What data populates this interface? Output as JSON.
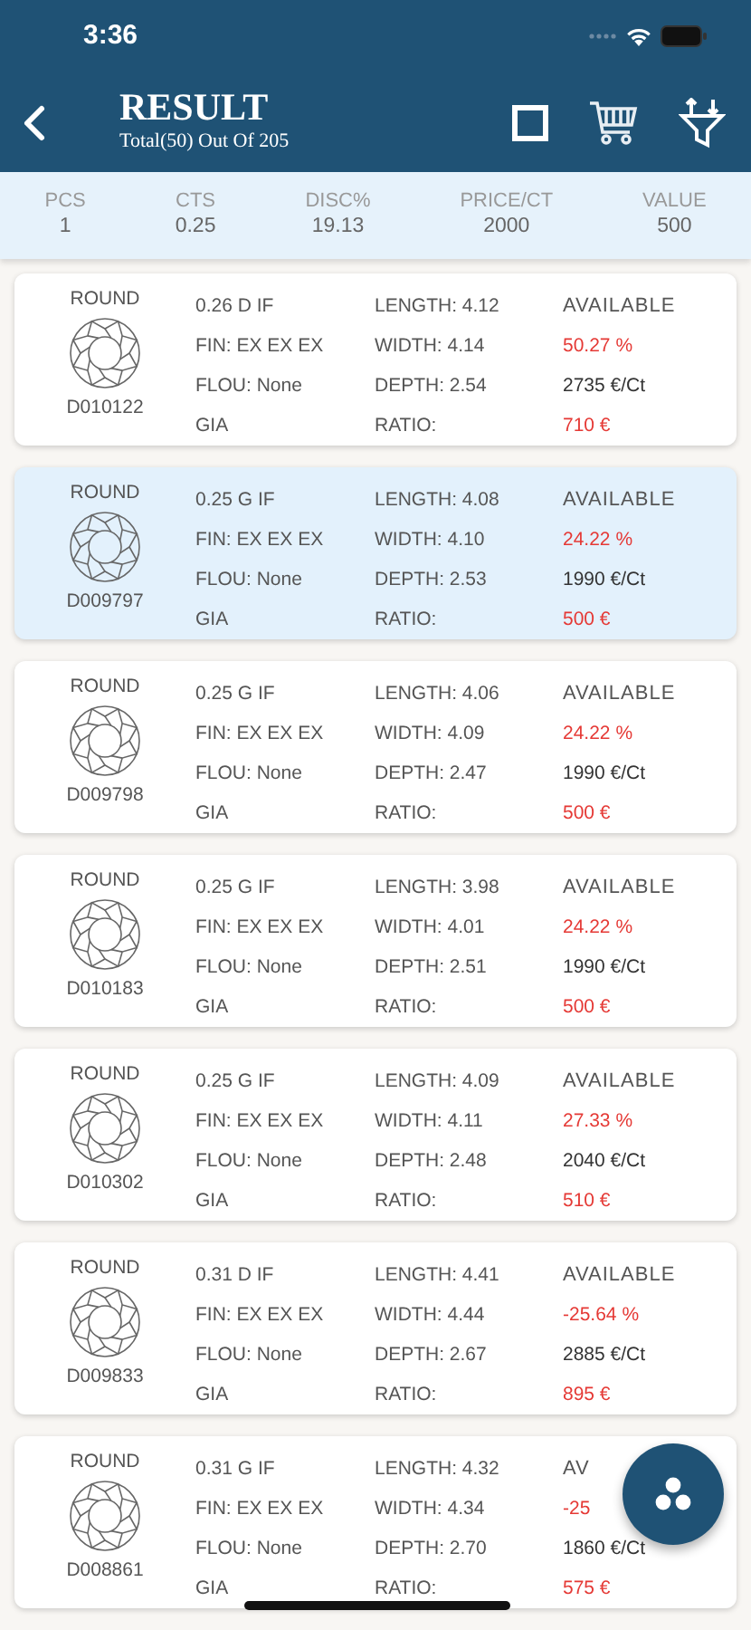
{
  "status_bar": {
    "time": "3:36"
  },
  "header": {
    "title": "RESULT",
    "subtitle": "Total(50) Out Of 205"
  },
  "summary": [
    {
      "label": "PCS",
      "value": "1"
    },
    {
      "label": "CTS",
      "value": "0.25"
    },
    {
      "label": "DISC%",
      "value": "19.13"
    },
    {
      "label": "PRICE/CT",
      "value": "2000"
    },
    {
      "label": "VALUE",
      "value": "500"
    }
  ],
  "stones": [
    {
      "shape": "ROUND",
      "stone_id": "D010122",
      "grade": "0.26 D IF",
      "finish": "FIN: EX EX EX",
      "fluorescence": "FLOU: None",
      "lab": "GIA",
      "length": "LENGTH: 4.12",
      "width": "WIDTH: 4.14",
      "depth": "DEPTH: 2.54",
      "ratio": "RATIO:",
      "status": "AVAILABLE",
      "discount": "50.27 %",
      "price_per_ct": "2735 €/Ct",
      "value": "710 €",
      "selected": false
    },
    {
      "shape": "ROUND",
      "stone_id": "D009797",
      "grade": "0.25 G IF",
      "finish": "FIN: EX EX EX",
      "fluorescence": "FLOU: None",
      "lab": "GIA",
      "length": "LENGTH: 4.08",
      "width": "WIDTH: 4.10",
      "depth": "DEPTH: 2.53",
      "ratio": "RATIO:",
      "status": "AVAILABLE",
      "discount": "24.22 %",
      "price_per_ct": "1990 €/Ct",
      "value": "500 €",
      "selected": true
    },
    {
      "shape": "ROUND",
      "stone_id": "D009798",
      "grade": "0.25 G IF",
      "finish": "FIN: EX EX EX",
      "fluorescence": "FLOU: None",
      "lab": "GIA",
      "length": "LENGTH: 4.06",
      "width": "WIDTH: 4.09",
      "depth": "DEPTH: 2.47",
      "ratio": "RATIO:",
      "status": "AVAILABLE",
      "discount": "24.22 %",
      "price_per_ct": "1990 €/Ct",
      "value": "500 €",
      "selected": false
    },
    {
      "shape": "ROUND",
      "stone_id": "D010183",
      "grade": "0.25 G IF",
      "finish": "FIN: EX EX EX",
      "fluorescence": "FLOU: None",
      "lab": "GIA",
      "length": "LENGTH: 3.98",
      "width": "WIDTH: 4.01",
      "depth": "DEPTH: 2.51",
      "ratio": "RATIO:",
      "status": "AVAILABLE",
      "discount": "24.22 %",
      "price_per_ct": "1990 €/Ct",
      "value": "500 €",
      "selected": false
    },
    {
      "shape": "ROUND",
      "stone_id": "D010302",
      "grade": "0.25 G IF",
      "finish": "FIN: EX EX EX",
      "fluorescence": "FLOU: None",
      "lab": "GIA",
      "length": "LENGTH: 4.09",
      "width": "WIDTH: 4.11",
      "depth": "DEPTH: 2.48",
      "ratio": "RATIO:",
      "status": "AVAILABLE",
      "discount": "27.33 %",
      "price_per_ct": "2040 €/Ct",
      "value": "510 €",
      "selected": false
    },
    {
      "shape": "ROUND",
      "stone_id": "D009833",
      "grade": "0.31 D IF",
      "finish": "FIN: EX EX EX",
      "fluorescence": "FLOU: None",
      "lab": "GIA",
      "length": "LENGTH: 4.41",
      "width": "WIDTH: 4.44",
      "depth": "DEPTH: 2.67",
      "ratio": "RATIO:",
      "status": "AVAILABLE",
      "discount": "-25.64 %",
      "price_per_ct": "2885 €/Ct",
      "value": "895 €",
      "selected": false
    },
    {
      "shape": "ROUND",
      "stone_id": "D008861",
      "grade": "0.31 G IF",
      "finish": "FIN: EX EX EX",
      "fluorescence": "FLOU: None",
      "lab": "GIA",
      "length": "LENGTH: 4.32",
      "width": "WIDTH: 4.34",
      "depth": "DEPTH: 2.70",
      "ratio": "RATIO:",
      "status": "AV",
      "discount": "-25",
      "price_per_ct": "1860 €/Ct",
      "value": "575 €",
      "selected": false
    }
  ]
}
